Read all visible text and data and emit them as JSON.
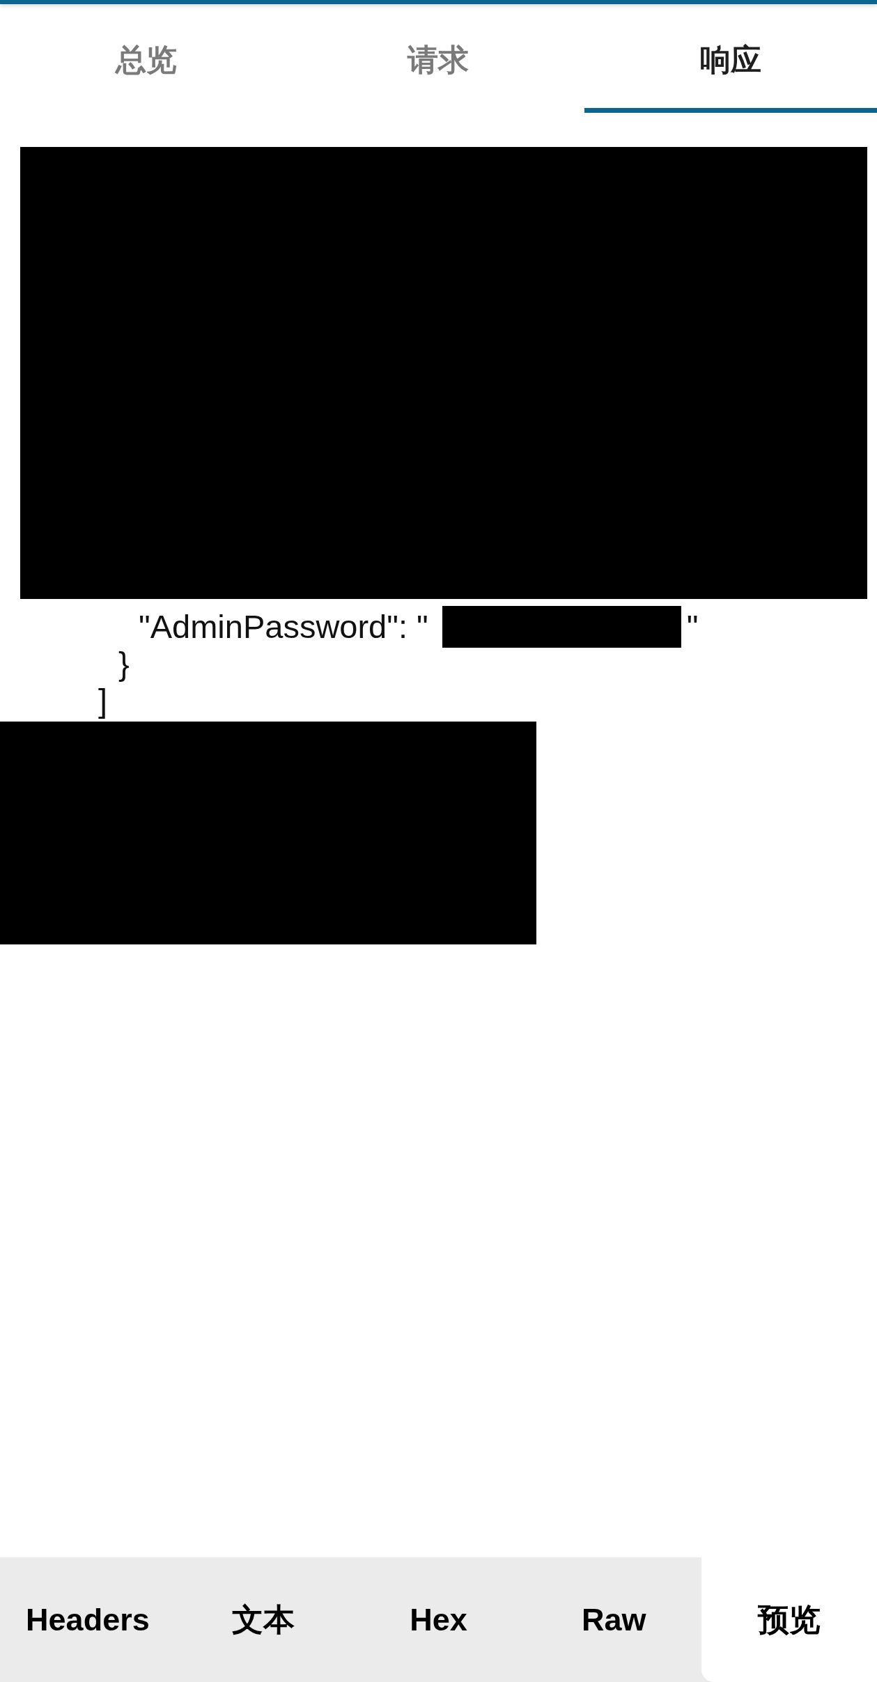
{
  "top_tabs": [
    {
      "label": "总览",
      "selected": false
    },
    {
      "label": "请求",
      "selected": false
    },
    {
      "label": "响应",
      "selected": true
    }
  ],
  "code": {
    "children": [
      {
        "children": [
          {
            "text": "\"AdminPassword\": \"",
            "redacted": true,
            "tail": "\""
          }
        ],
        "close": "}"
      }
    ],
    "close": "]"
  },
  "bottom_tabs": [
    {
      "label": "Headers",
      "selected": false
    },
    {
      "label": "文本",
      "selected": false
    },
    {
      "label": "Hex",
      "selected": false
    },
    {
      "label": "Raw",
      "selected": false
    },
    {
      "label": "预览",
      "selected": true
    }
  ]
}
